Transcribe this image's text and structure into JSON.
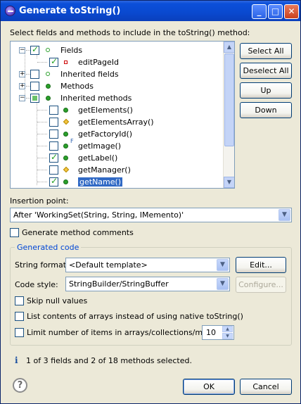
{
  "window": {
    "title": "Generate toString()"
  },
  "titlebar_buttons": {
    "minimize": "_",
    "maximize": "□",
    "close": "✕"
  },
  "instruction": "Select fields and methods to include in the toString() method:",
  "tree": {
    "items": [
      {
        "label": "Fields",
        "checked": "checked",
        "expanded": true,
        "icon": "field-group-icon"
      },
      {
        "label": "editPageId",
        "checked": "checked",
        "icon": "private-field-icon"
      },
      {
        "label": "Inherited fields",
        "checked": "unchecked",
        "expanded": false,
        "icon": "field-group-icon"
      },
      {
        "label": "Methods",
        "checked": "unchecked",
        "expanded": false,
        "icon": "method-group-icon"
      },
      {
        "label": "Inherited methods",
        "checked": "partial",
        "expanded": true,
        "icon": "method-group-icon"
      },
      {
        "label": "getElements()",
        "checked": "unchecked",
        "icon": "public-method-icon"
      },
      {
        "label": "getElementsArray()",
        "checked": "unchecked",
        "icon": "protected-method-icon"
      },
      {
        "label": "getFactoryId()",
        "checked": "unchecked",
        "icon": "public-method-icon"
      },
      {
        "label": "getImage()",
        "checked": "unchecked",
        "icon": "public-method-icon"
      },
      {
        "label": "getLabel()",
        "checked": "checked",
        "icon": "public-method-icon"
      },
      {
        "label": "getManager()",
        "checked": "unchecked",
        "icon": "protected-method-icon"
      },
      {
        "label": "getName()",
        "checked": "checked",
        "icon": "public-method-icon",
        "selected": true
      }
    ],
    "final_marker": "F"
  },
  "side_buttons": {
    "select_all": "Select All",
    "deselect_all": "Deselect All",
    "up": "Up",
    "down": "Down"
  },
  "insertion": {
    "label": "Insertion point:",
    "value": "After 'WorkingSet(String, String, IMemento)'"
  },
  "generate_comments": {
    "label": "Generate method comments",
    "checked": false
  },
  "generated_code": {
    "title": "Generated code",
    "string_format": {
      "label": "String format:",
      "value": "<Default template>",
      "button": "Edit..."
    },
    "code_style": {
      "label": "Code style:",
      "value": "StringBuilder/StringBuffer",
      "button": "Configure..."
    },
    "skip_nulls": {
      "label": "Skip null values",
      "checked": false
    },
    "list_arrays": {
      "label": "List contents of arrays instead of using native toString()",
      "checked": false
    },
    "limit_items": {
      "label": "Limit number of items in arrays/collections/maps to",
      "checked": false,
      "value": "10"
    }
  },
  "status": {
    "icon": "info-icon",
    "text": "1 of 3 fields and 2 of 18 methods selected."
  },
  "footer": {
    "help": "?",
    "ok": "OK",
    "cancel": "Cancel"
  }
}
